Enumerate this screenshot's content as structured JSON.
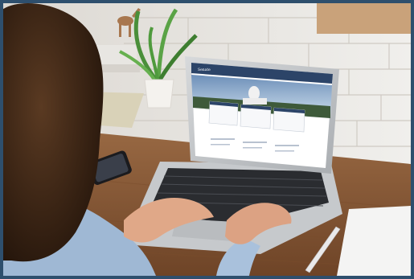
{
  "scene": {
    "description_alt": "",
    "colors": {
      "frame_border": "#2e4f6d",
      "brick_wall": "#eae8e4",
      "desk_wood": "#8a5a36",
      "laptop_body": "#c9cccf",
      "screen_header": "#2c4468",
      "shirt": "#9fb8d4",
      "hair": "#3a2416"
    }
  },
  "screen": {
    "brand_text": "Senate"
  }
}
